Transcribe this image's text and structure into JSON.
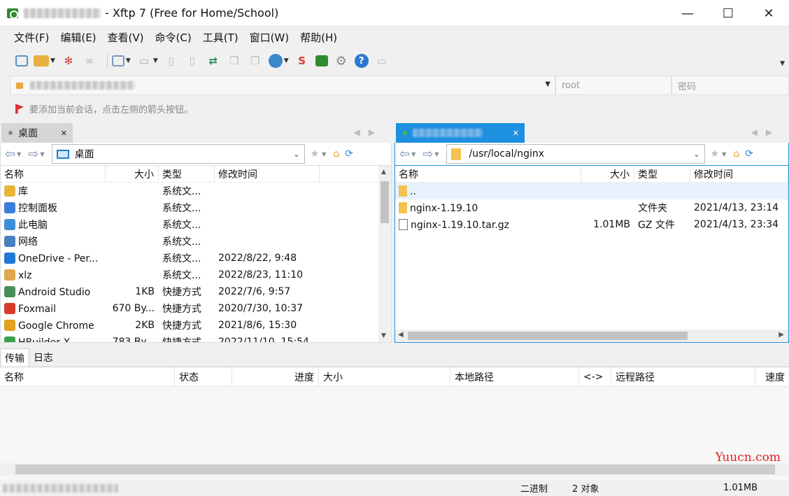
{
  "window": {
    "title": "- Xftp 7 (Free for Home/School)",
    "minimize": "—",
    "maximize": "☐",
    "close": "✕"
  },
  "menu": [
    "文件(F)",
    "编辑(E)",
    "查看(V)",
    "命令(C)",
    "工具(T)",
    "窗口(W)",
    "帮助(H)"
  ],
  "address": {
    "user_placeholder": "root",
    "password_placeholder": "密码"
  },
  "hint": "要添加当前会话，点击左侧的箭头按钮。",
  "left": {
    "tab_label": "桌面",
    "path": "桌面",
    "headers": [
      "名称",
      "大小",
      "类型",
      "修改时间"
    ],
    "rows": [
      {
        "name": "库",
        "size": "",
        "type": "系统文...",
        "modified": "",
        "icon": "library-icon",
        "color": "#e9b43a"
      },
      {
        "name": "控制面板",
        "size": "",
        "type": "系统文...",
        "modified": "",
        "icon": "control-panel-icon",
        "color": "#3b7dd8"
      },
      {
        "name": "此电脑",
        "size": "",
        "type": "系统文...",
        "modified": "",
        "icon": "computer-icon",
        "color": "#3b8fd8"
      },
      {
        "name": "网络",
        "size": "",
        "type": "系统文...",
        "modified": "",
        "icon": "network-icon",
        "color": "#4a7fc0"
      },
      {
        "name": "OneDrive - Per...",
        "size": "",
        "type": "系统文...",
        "modified": "2022/8/22, 9:48",
        "icon": "onedrive-icon",
        "color": "#1f78d1"
      },
      {
        "name": "xlz",
        "size": "",
        "type": "系统文...",
        "modified": "2022/8/23, 11:10",
        "icon": "user-folder-icon",
        "color": "#e0a84a"
      },
      {
        "name": "Android Studio",
        "size": "1KB",
        "type": "快捷方式",
        "modified": "2022/7/6, 9:57",
        "icon": "android-studio-icon",
        "color": "#4a8f5a"
      },
      {
        "name": "Foxmail",
        "size": "670 By...",
        "type": "快捷方式",
        "modified": "2020/7/30, 10:37",
        "icon": "foxmail-icon",
        "color": "#d83a2a"
      },
      {
        "name": "Google Chrome",
        "size": "2KB",
        "type": "快捷方式",
        "modified": "2021/8/6, 15:30",
        "icon": "chrome-icon",
        "color": "#e0a020"
      },
      {
        "name": "HBuilder X",
        "size": "783 By...",
        "type": "快捷方式",
        "modified": "2022/11/10, 15:54",
        "icon": "hbuilder-icon",
        "color": "#3aa34a"
      }
    ]
  },
  "right": {
    "path": "/usr/local/nginx",
    "headers": [
      "名称",
      "大小",
      "类型",
      "修改时间"
    ],
    "rows": [
      {
        "name": "..",
        "size": "",
        "type": "",
        "modified": "",
        "icon": "folder-icon",
        "color": "#f3c250"
      },
      {
        "name": "nginx-1.19.10",
        "size": "",
        "type": "文件夹",
        "modified": "2021/4/13, 23:14",
        "icon": "folder-icon",
        "color": "#f3c250"
      },
      {
        "name": "nginx-1.19.10.tar.gz",
        "size": "1.01MB",
        "type": "GZ 文件",
        "modified": "2021/4/13, 23:34",
        "icon": "file-icon",
        "color": "#ffffff"
      }
    ]
  },
  "transfer": {
    "tabs": [
      "传输",
      "日志"
    ],
    "headers": [
      "名称",
      "状态",
      "进度",
      "大小",
      "本地路径",
      "<->",
      "远程路径",
      "速度"
    ]
  },
  "status": {
    "mode": "二进制",
    "objects": "2 对象",
    "size": "1.01MB"
  },
  "watermark": "Yuucn.com"
}
